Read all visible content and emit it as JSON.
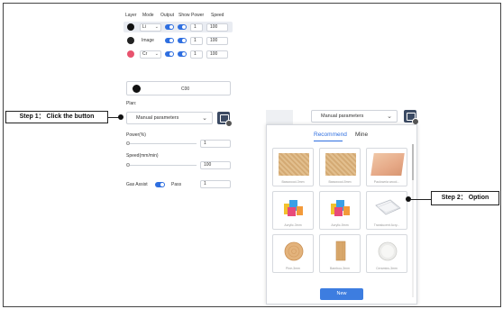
{
  "layer_table": {
    "headers": [
      "Layer",
      "Mode",
      "Output",
      "Show",
      "Power",
      "Speed"
    ],
    "rows": [
      {
        "color": "#111111",
        "mode": "Li",
        "power": "1",
        "speed": "100",
        "selected": true
      },
      {
        "color": "#222222",
        "mode": "Image",
        "power": "1",
        "speed": "100",
        "selected": false
      },
      {
        "color": "#e8536e",
        "mode": "Cr",
        "power": "1",
        "speed": "100",
        "selected": false
      }
    ]
  },
  "layer_color": {
    "swatch": "#111111",
    "label": "C00"
  },
  "plan": {
    "label": "Plan:",
    "select_value": "Manual parameters",
    "popup_select_value": "Manual parameters"
  },
  "params": {
    "power_label": "Power(%)",
    "power_value": "1",
    "power_level": 0.0,
    "speed_label": "Speed(mm/min)",
    "speed_value": "100",
    "speed_level": 0.0,
    "gas_assist_label": "Gas Assist",
    "gas_assist_on": true,
    "pass_label": "Pass",
    "pass_value": "1"
  },
  "callouts": {
    "step1": "Step 1：  Click the button",
    "step2": "Step 2：  Option"
  },
  "popup": {
    "tabs": [
      {
        "label": "Recommend",
        "active": true
      },
      {
        "label": "Mine",
        "active": false
      }
    ],
    "materials": [
      {
        "label": "Basswood-3mm",
        "icon": "basswood-icon"
      },
      {
        "label": "Basswood-5mm",
        "icon": "basswood-icon"
      },
      {
        "label": "Paulownia wood...",
        "icon": "paulownia-wood-icon"
      },
      {
        "label": "Acrylic-3mm",
        "icon": "acrylic-icon"
      },
      {
        "label": "Acrylic-5mm",
        "icon": "acrylic-icon"
      },
      {
        "label": "Translucent Acry...",
        "icon": "translucent-acrylic-icon"
      },
      {
        "label": "Pine-3mm",
        "icon": "pine-icon"
      },
      {
        "label": "Bamboo-3mm",
        "icon": "bamboo-icon"
      },
      {
        "label": "Ceramics-3mm",
        "icon": "ceramics-icon"
      }
    ],
    "new_button": "New"
  },
  "colors": {
    "accent": "#2f6fe0",
    "save_button": "#3b4a63",
    "new_button": "#3d7de0"
  }
}
